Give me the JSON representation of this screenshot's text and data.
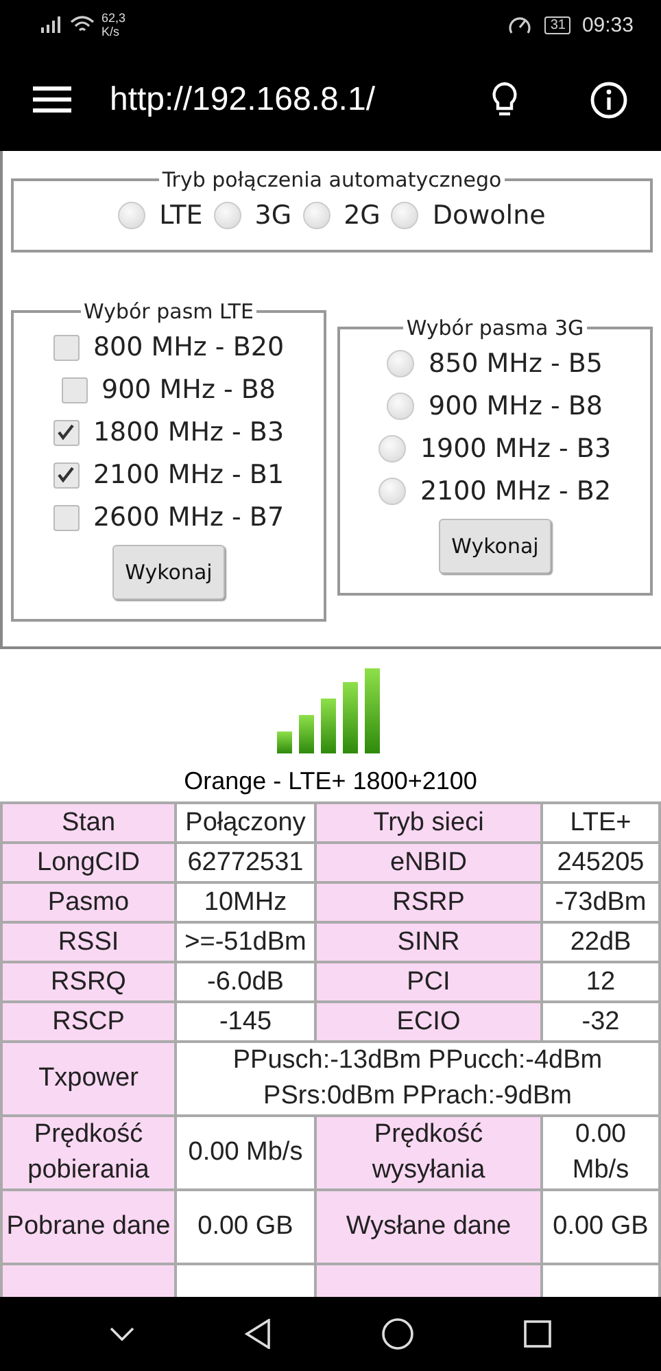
{
  "status_bar": {
    "speed": "62,3",
    "speed_unit": "K/s",
    "battery": "31",
    "time": "09:33"
  },
  "app_bar": {
    "title": "http://192.168.8.1/"
  },
  "mode": {
    "legend": "Tryb połączenia automatycznego",
    "options": [
      {
        "label": "LTE",
        "selected": false
      },
      {
        "label": "3G",
        "selected": false
      },
      {
        "label": "2G",
        "selected": false
      },
      {
        "label": "Dowolne",
        "selected": false
      }
    ]
  },
  "lte_bands": {
    "legend": "Wybór pasm LTE",
    "items": [
      {
        "label": "800 MHz - B20",
        "checked": false
      },
      {
        "label": "900 MHz - B8",
        "checked": false
      },
      {
        "label": "1800 MHz - B3",
        "checked": true
      },
      {
        "label": "2100 MHz - B1",
        "checked": true
      },
      {
        "label": "2600 MHz - B7",
        "checked": false
      }
    ],
    "button": "Wykonaj"
  },
  "umts_bands": {
    "legend": "Wybór pasma 3G",
    "items": [
      {
        "label": "850 MHz - B5",
        "selected": false
      },
      {
        "label": "900 MHz - B8",
        "selected": false
      },
      {
        "label": "1900 MHz - B3",
        "selected": false
      },
      {
        "label": "2100 MHz - B2",
        "selected": false
      }
    ],
    "button": "Wykonaj"
  },
  "network": {
    "caption": "Orange - LTE+ 1800+2100"
  },
  "table": {
    "rows": [
      {
        "cells": [
          "Stan",
          "Połączony",
          "Tryb sieci",
          "LTE+"
        ]
      },
      {
        "cells": [
          "LongCID",
          "62772531",
          "eNBID",
          "245205"
        ]
      },
      {
        "cells": [
          "Pasmo",
          "10MHz",
          "RSRP",
          "-73dBm"
        ]
      },
      {
        "cells": [
          "RSSI",
          ">=-51dBm",
          "SINR",
          "22dB"
        ]
      },
      {
        "cells": [
          "RSRQ",
          "-6.0dB",
          "PCI",
          "12"
        ]
      },
      {
        "cells": [
          "RSCP",
          "-145",
          "ECIO",
          "-32"
        ]
      },
      {
        "cells": [
          "Txpower",
          {
            "text": "PPusch:-13dBm PPucch:-4dBm PSrs:0dBm PPrach:-9dBm",
            "colspan": 3
          }
        ]
      },
      {
        "cells": [
          "Prędkość pobierania",
          "0.00 Mb/s",
          "Prędkość wysyłania",
          "0.00 Mb/s"
        ]
      },
      {
        "cells": [
          "Pobrane dane",
          "0.00 GB",
          "Wysłane dane",
          "0.00 GB"
        ]
      }
    ]
  }
}
